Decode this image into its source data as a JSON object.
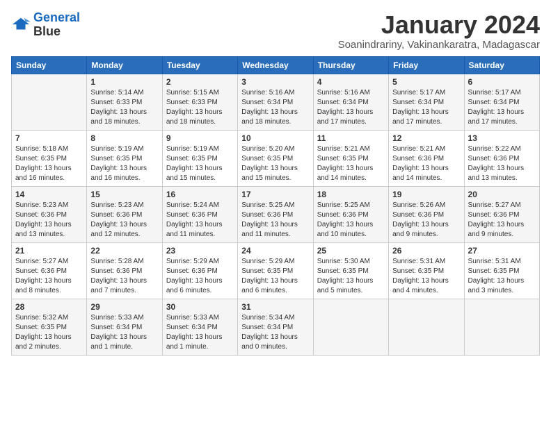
{
  "logo": {
    "line1": "General",
    "line2": "Blue"
  },
  "title": "January 2024",
  "subtitle": "Soanindrariny, Vakinankaratra, Madagascar",
  "days_of_week": [
    "Sunday",
    "Monday",
    "Tuesday",
    "Wednesday",
    "Thursday",
    "Friday",
    "Saturday"
  ],
  "weeks": [
    [
      {
        "num": "",
        "info": ""
      },
      {
        "num": "1",
        "info": "Sunrise: 5:14 AM\nSunset: 6:33 PM\nDaylight: 13 hours\nand 18 minutes."
      },
      {
        "num": "2",
        "info": "Sunrise: 5:15 AM\nSunset: 6:33 PM\nDaylight: 13 hours\nand 18 minutes."
      },
      {
        "num": "3",
        "info": "Sunrise: 5:16 AM\nSunset: 6:34 PM\nDaylight: 13 hours\nand 18 minutes."
      },
      {
        "num": "4",
        "info": "Sunrise: 5:16 AM\nSunset: 6:34 PM\nDaylight: 13 hours\nand 17 minutes."
      },
      {
        "num": "5",
        "info": "Sunrise: 5:17 AM\nSunset: 6:34 PM\nDaylight: 13 hours\nand 17 minutes."
      },
      {
        "num": "6",
        "info": "Sunrise: 5:17 AM\nSunset: 6:34 PM\nDaylight: 13 hours\nand 17 minutes."
      }
    ],
    [
      {
        "num": "7",
        "info": "Sunrise: 5:18 AM\nSunset: 6:35 PM\nDaylight: 13 hours\nand 16 minutes."
      },
      {
        "num": "8",
        "info": "Sunrise: 5:19 AM\nSunset: 6:35 PM\nDaylight: 13 hours\nand 16 minutes."
      },
      {
        "num": "9",
        "info": "Sunrise: 5:19 AM\nSunset: 6:35 PM\nDaylight: 13 hours\nand 15 minutes."
      },
      {
        "num": "10",
        "info": "Sunrise: 5:20 AM\nSunset: 6:35 PM\nDaylight: 13 hours\nand 15 minutes."
      },
      {
        "num": "11",
        "info": "Sunrise: 5:21 AM\nSunset: 6:35 PM\nDaylight: 13 hours\nand 14 minutes."
      },
      {
        "num": "12",
        "info": "Sunrise: 5:21 AM\nSunset: 6:36 PM\nDaylight: 13 hours\nand 14 minutes."
      },
      {
        "num": "13",
        "info": "Sunrise: 5:22 AM\nSunset: 6:36 PM\nDaylight: 13 hours\nand 13 minutes."
      }
    ],
    [
      {
        "num": "14",
        "info": "Sunrise: 5:23 AM\nSunset: 6:36 PM\nDaylight: 13 hours\nand 13 minutes."
      },
      {
        "num": "15",
        "info": "Sunrise: 5:23 AM\nSunset: 6:36 PM\nDaylight: 13 hours\nand 12 minutes."
      },
      {
        "num": "16",
        "info": "Sunrise: 5:24 AM\nSunset: 6:36 PM\nDaylight: 13 hours\nand 11 minutes."
      },
      {
        "num": "17",
        "info": "Sunrise: 5:25 AM\nSunset: 6:36 PM\nDaylight: 13 hours\nand 11 minutes."
      },
      {
        "num": "18",
        "info": "Sunrise: 5:25 AM\nSunset: 6:36 PM\nDaylight: 13 hours\nand 10 minutes."
      },
      {
        "num": "19",
        "info": "Sunrise: 5:26 AM\nSunset: 6:36 PM\nDaylight: 13 hours\nand 9 minutes."
      },
      {
        "num": "20",
        "info": "Sunrise: 5:27 AM\nSunset: 6:36 PM\nDaylight: 13 hours\nand 9 minutes."
      }
    ],
    [
      {
        "num": "21",
        "info": "Sunrise: 5:27 AM\nSunset: 6:36 PM\nDaylight: 13 hours\nand 8 minutes."
      },
      {
        "num": "22",
        "info": "Sunrise: 5:28 AM\nSunset: 6:36 PM\nDaylight: 13 hours\nand 7 minutes."
      },
      {
        "num": "23",
        "info": "Sunrise: 5:29 AM\nSunset: 6:36 PM\nDaylight: 13 hours\nand 6 minutes."
      },
      {
        "num": "24",
        "info": "Sunrise: 5:29 AM\nSunset: 6:35 PM\nDaylight: 13 hours\nand 6 minutes."
      },
      {
        "num": "25",
        "info": "Sunrise: 5:30 AM\nSunset: 6:35 PM\nDaylight: 13 hours\nand 5 minutes."
      },
      {
        "num": "26",
        "info": "Sunrise: 5:31 AM\nSunset: 6:35 PM\nDaylight: 13 hours\nand 4 minutes."
      },
      {
        "num": "27",
        "info": "Sunrise: 5:31 AM\nSunset: 6:35 PM\nDaylight: 13 hours\nand 3 minutes."
      }
    ],
    [
      {
        "num": "28",
        "info": "Sunrise: 5:32 AM\nSunset: 6:35 PM\nDaylight: 13 hours\nand 2 minutes."
      },
      {
        "num": "29",
        "info": "Sunrise: 5:33 AM\nSunset: 6:34 PM\nDaylight: 13 hours\nand 1 minute."
      },
      {
        "num": "30",
        "info": "Sunrise: 5:33 AM\nSunset: 6:34 PM\nDaylight: 13 hours\nand 1 minute."
      },
      {
        "num": "31",
        "info": "Sunrise: 5:34 AM\nSunset: 6:34 PM\nDaylight: 13 hours\nand 0 minutes."
      },
      {
        "num": "",
        "info": ""
      },
      {
        "num": "",
        "info": ""
      },
      {
        "num": "",
        "info": ""
      }
    ]
  ]
}
